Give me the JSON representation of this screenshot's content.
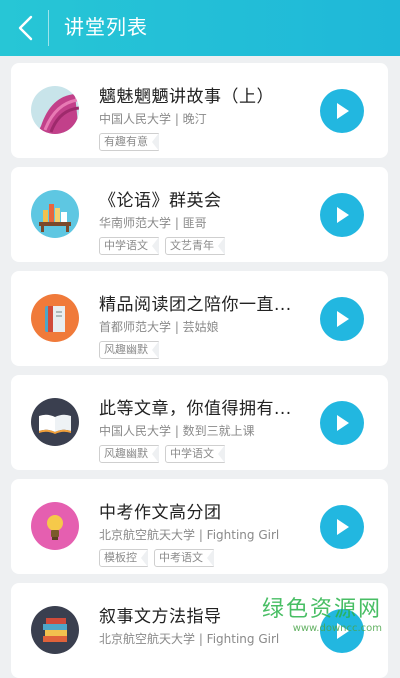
{
  "header": {
    "title": "讲堂列表"
  },
  "colors": {
    "header": "#27c6d6",
    "play_button": "#22b7e0",
    "background": "#eef0f2"
  },
  "items": [
    {
      "title": "魑魅魍魉讲故事（上）",
      "meta": "中国人民大学 | 晚汀",
      "tags": [
        "有趣有意"
      ],
      "thumb_icon": "yarn-icon"
    },
    {
      "title": "《论语》群英会",
      "meta": "华南师范大学 | 匪哥",
      "tags": [
        "中学语文",
        "文艺青年"
      ],
      "thumb_icon": "library-icon"
    },
    {
      "title": "精品阅读团之陪你一直...",
      "meta": "首都师范大学 | 芸姑娘",
      "tags": [
        "风趣幽默"
      ],
      "thumb_icon": "book-icon"
    },
    {
      "title": "此等文章，你值得拥有...",
      "meta": "中国人民大学 | 数到三就上课",
      "tags": [
        "风趣幽默",
        "中学语文"
      ],
      "thumb_icon": "open-book-icon"
    },
    {
      "title": "中考作文高分团",
      "meta": "北京航空航天大学 | Fighting Girl",
      "tags": [
        "模板控",
        "中考语文"
      ],
      "thumb_icon": "lightbulb-icon"
    },
    {
      "title": "叙事文方法指导",
      "meta": "北京航空航天大学 | Fighting Girl",
      "tags": [],
      "thumb_icon": "book-stack-icon"
    }
  ],
  "watermark": {
    "text": "绿色资源网",
    "sub": "www.downcc.com"
  }
}
